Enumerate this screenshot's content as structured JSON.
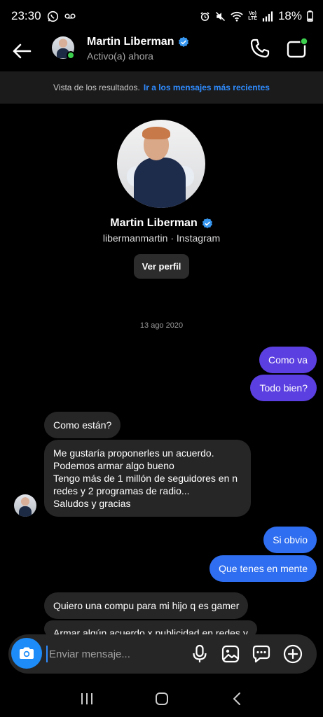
{
  "status_bar": {
    "time": "23:30",
    "battery": "18%"
  },
  "header": {
    "name": "Martin Liberman",
    "status": "Activo(a) ahora"
  },
  "banner": {
    "text": "Vista de los resultados.",
    "link": "Ir a los mensajes más recientes"
  },
  "profile": {
    "name": "Martin Liberman",
    "subtitle": "libermanmartin · Instagram",
    "view_button": "Ver perfil"
  },
  "conversation": {
    "date": "13 ago 2020",
    "messages": [
      {
        "text": "Como va",
        "from": "me"
      },
      {
        "text": "Todo bien?",
        "from": "me"
      },
      {
        "text": "Como están?",
        "from": "them"
      },
      {
        "text": "Me gustaría proponerles un acuerdo.\nPodemos armar algo bueno\nTengo más de 1 millón de seguidores en n\nredes y 2 programas de radio...\nSaludos y gracias",
        "from": "them"
      },
      {
        "text": "Si obvio",
        "from": "me"
      },
      {
        "text": "Que tenes en mente",
        "from": "me"
      },
      {
        "text": "Quiero una compu para mi hijo q es gamer",
        "from": "them"
      },
      {
        "text": "Armar algún acuerdo x publicidad en redes y",
        "from": "them"
      }
    ]
  },
  "composer": {
    "placeholder": "Enviar mensaje..."
  },
  "icons": [
    "back-arrow-icon",
    "verified-badge-icon",
    "phone-icon",
    "video-camera-icon",
    "camera-icon",
    "microphone-icon",
    "gallery-icon",
    "sticker-icon",
    "plus-icon",
    "recents-icon",
    "home-icon",
    "nav-back-icon"
  ],
  "colors": {
    "background": "#000000",
    "incoming_bubble": "#262626",
    "outgoing_purple": "#5b3fe0",
    "outgoing_blue": "#2f6ef0",
    "link": "#2f8cff",
    "verified": "#3797f0",
    "online": "#3ccf4e",
    "camera_button": "#1d8cf8"
  }
}
